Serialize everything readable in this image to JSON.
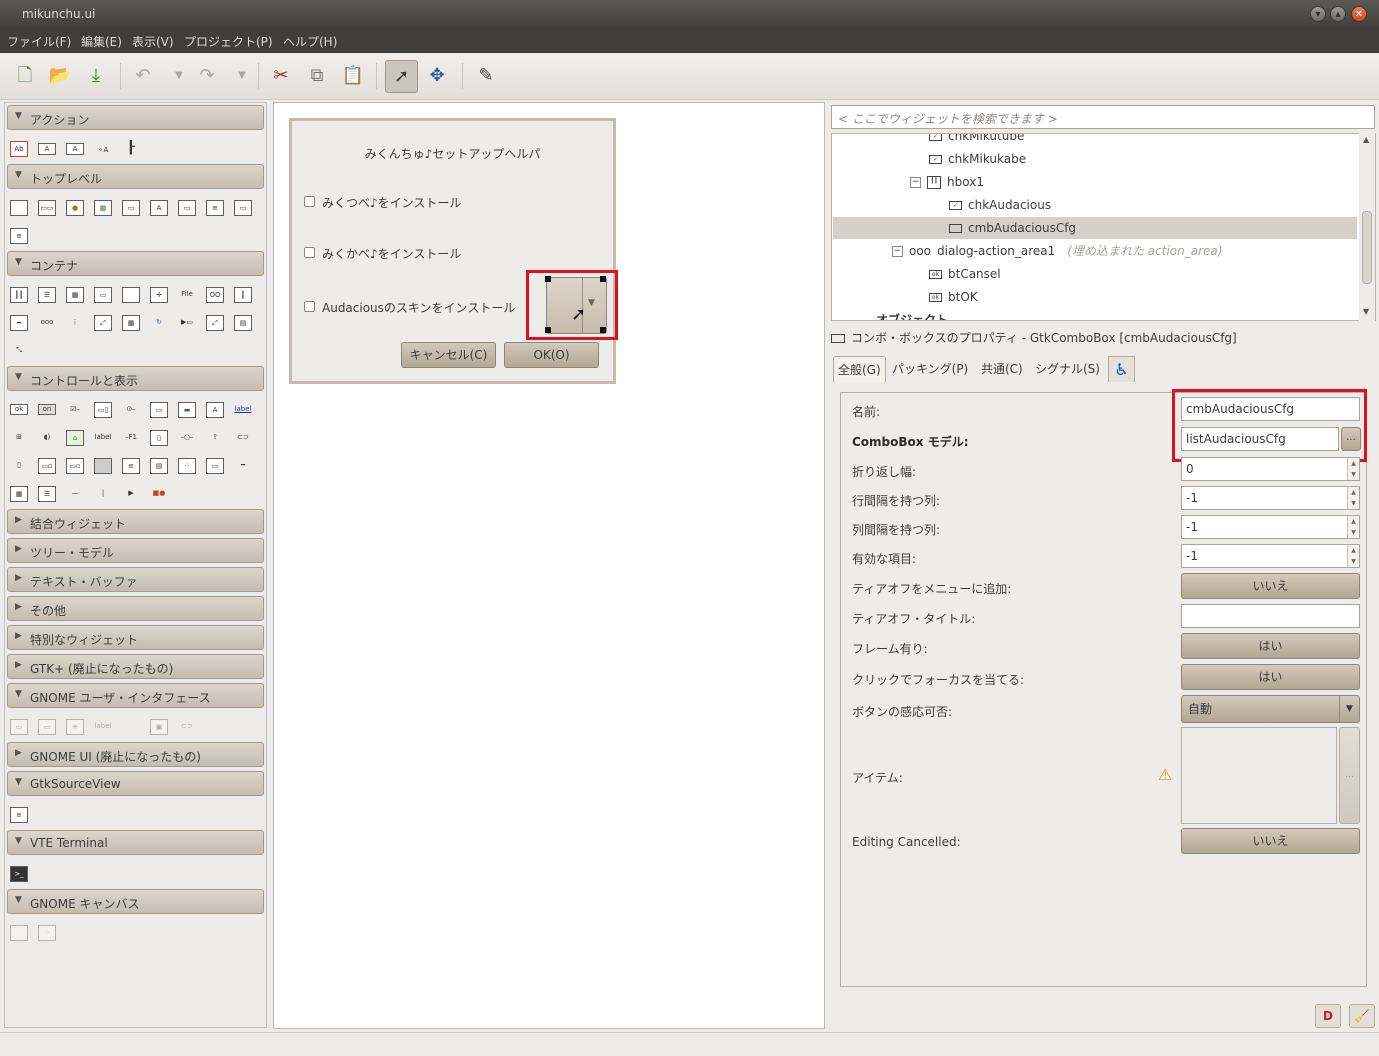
{
  "window": {
    "title": "mikunchu.ui"
  },
  "menu": [
    "ファイル(F)",
    "編集(E)",
    "表示(V)",
    "プロジェクト(P)",
    "ヘルプ(H)"
  ],
  "palette": {
    "categories": [
      {
        "label": "アクション",
        "expanded": true
      },
      {
        "label": "トップレベル",
        "expanded": true
      },
      {
        "label": "コンテナ",
        "expanded": true
      },
      {
        "label": "コントロールと表示",
        "expanded": true
      },
      {
        "label": "結合ウィジェット",
        "expanded": false
      },
      {
        "label": "ツリー・モデル",
        "expanded": false
      },
      {
        "label": "テキスト・バッファ",
        "expanded": false
      },
      {
        "label": "その他",
        "expanded": false
      },
      {
        "label": "特別なウィジェット",
        "expanded": false
      },
      {
        "label": "GTK+ (廃止になったもの)",
        "expanded": false
      },
      {
        "label": "GNOME ユーザ・インタフェース",
        "expanded": true
      },
      {
        "label": "GNOME UI (廃止になったもの)",
        "expanded": false
      },
      {
        "label": "GtkSourceView",
        "expanded": true
      },
      {
        "label": "VTE Terminal",
        "expanded": true
      },
      {
        "label": "GNOME キャンバス",
        "expanded": true
      }
    ],
    "icon_labels": {
      "file": "File",
      "label": "label",
      "f1": "F1"
    }
  },
  "dialog": {
    "title": "みくんちゅ♪セットアップヘルパ",
    "checkboxes": [
      "みくつべ♪をインストール",
      "みくかべ♪をインストール",
      "Audaciousのスキンをインストール"
    ],
    "cancel": "キャンセル(C)",
    "ok": "OK(O)"
  },
  "search": {
    "placeholder": "< ここでウィジェットを検索できます >"
  },
  "tree": {
    "rows": [
      {
        "label": "chkMikutube",
        "selected": false
      },
      {
        "label": "chkMikukabe",
        "selected": false
      },
      {
        "label": "hbox1",
        "selected": false
      },
      {
        "label": "chkAudacious",
        "selected": false
      },
      {
        "label": "cmbAudaciousCfg",
        "selected": true
      },
      {
        "label": "dialog-action_area1",
        "note": "(埋め込まれた action_area)",
        "selected": false
      },
      {
        "label": "btCansel",
        "selected": false
      },
      {
        "label": "btOK",
        "selected": false
      },
      {
        "label": "オブジェクト",
        "selected": false
      }
    ]
  },
  "properties": {
    "caption": "コンボ・ボックスのプロパティ - GtkComboBox [cmbAudaciousCfg]",
    "tabs": [
      "全般(G)",
      "パッキング(P)",
      "共通(C)",
      "シグナル(S)"
    ],
    "rows": {
      "name": {
        "label": "名前:",
        "value": "cmbAudaciousCfg"
      },
      "model": {
        "label": "ComboBox モデル:",
        "value": "listAudaciousCfg",
        "button": "..."
      },
      "wrap": {
        "label": "折り返し幅:",
        "value": "0"
      },
      "rowspan": {
        "label": "行間隔を持つ列:",
        "value": "-1"
      },
      "colspan": {
        "label": "列間隔を持つ列:",
        "value": "-1"
      },
      "active": {
        "label": "有効な項目:",
        "value": "-1"
      },
      "tearoff": {
        "label": "ティアオフをメニューに追加:",
        "value": "いいえ"
      },
      "tearoff_title": {
        "label": "ティアオフ・タイトル:",
        "value": ""
      },
      "frame": {
        "label": "フレーム有り:",
        "value": "はい"
      },
      "focus": {
        "label": "クリックでフォーカスを当てる:",
        "value": "はい"
      },
      "sensitivity": {
        "label": "ボタンの感応可否:",
        "value": "自動"
      },
      "items": {
        "label": "アイテム:",
        "button": "..."
      },
      "editing": {
        "label": "Editing Cancelled:",
        "value": "いいえ"
      }
    }
  },
  "colors": {
    "highlight": "#e0111b",
    "button": "#c2b9a8"
  }
}
